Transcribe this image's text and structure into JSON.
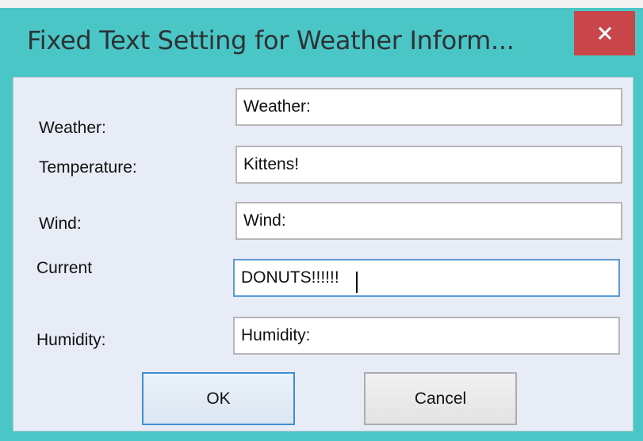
{
  "window": {
    "title": "Fixed Text Setting for Weather Inform...",
    "close_glyph": "×",
    "close_icon": "close-icon"
  },
  "colors": {
    "title_bar": "#4bc6c6",
    "close_button": "#c8464a",
    "client_background": "#e8ecf6",
    "focus_border": "#5a9bd5",
    "default_button_border": "#3c8fd6"
  },
  "fields": {
    "weather": {
      "label": "Weather:",
      "value": "Weather:"
    },
    "temperature": {
      "label": "Temperature:",
      "value": "Kittens!"
    },
    "wind": {
      "label": "Wind:",
      "value": "Wind:"
    },
    "current": {
      "label": "Current",
      "value": "DONUTS!!!!!!"
    },
    "humidity": {
      "label": "Humidity:",
      "value": "Humidity:"
    }
  },
  "buttons": {
    "ok": "OK",
    "cancel": "Cancel"
  }
}
